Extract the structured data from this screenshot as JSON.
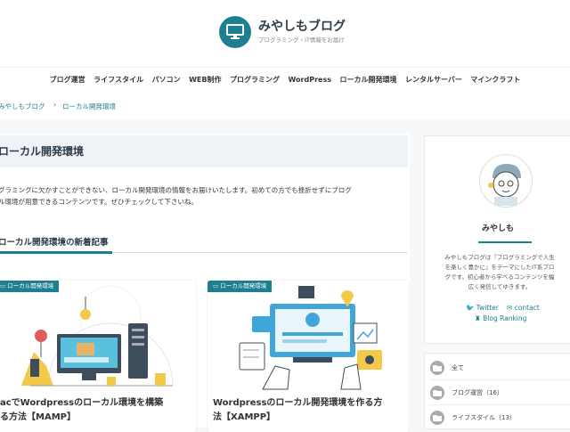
{
  "site": {
    "title": "みやしもブログ",
    "description": "プログラミング・IT情報をお届け"
  },
  "nav": [
    "ブログ運営",
    "ライフスタイル",
    "パソコン",
    "WEB制作",
    "プログラミング",
    "WordPress",
    "ローカル開発環境",
    "レンタルサーバー",
    "マインクラフト"
  ],
  "breadcrumb": [
    "みやしもブログ",
    "ローカル開発環境"
  ],
  "category": {
    "title": "ローカル開発環境",
    "description_line1": "グラミングに欠かすことができない、ローカル開発環境の情報をお届けいたします。初めての方でも挫折せずにブログ",
    "description_line2": "ル環境が用意できるコンテンツです。ぜひチェックして下さいね。"
  },
  "new_articles_title": "ローカル開発環境の新着記事",
  "cards": [
    {
      "label": "ローカル開発環境",
      "title_line1": "acでWordpressのローカル環境を構築",
      "title_line2": "る方法【MAMP】"
    },
    {
      "label": "ローカル開発環境",
      "title_line1": "Wordpressのローカル開発環境を作る方",
      "title_line2": "法【XAMPP】"
    }
  ],
  "profile": {
    "name": "みやしも",
    "text_line1": "みやしもブログは『プログラミングで人生",
    "text_line2": "を楽しく豊かに』をテーマにしたIT系ブロ",
    "text_line3": "グです。初心者から学べるコンテンツを幅",
    "text_line4": "広く発信してゆきます。",
    "twitter": "Twitter",
    "contact": "contact",
    "blog_ranking": "Blog Ranking"
  },
  "sidebar_categories": [
    "全て",
    "ブログ運営（16）",
    "ライフスタイル（13）"
  ],
  "colors": {
    "accent": "#1d7f8f",
    "navy": "#2a3b49"
  }
}
